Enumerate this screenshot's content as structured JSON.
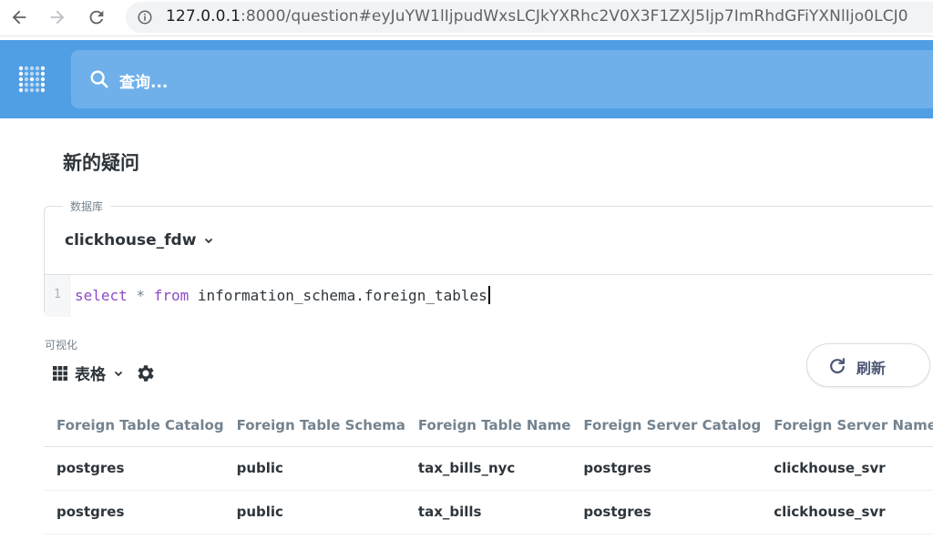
{
  "browser": {
    "url_host": "127.0.0.1",
    "url_rest": ":8000/question#eyJuYW1lIjpudWxsLCJkYXRhc2V0X3F1ZXJ5Ijp7ImRhdGFiYXNlIjo0LCJ0"
  },
  "header": {
    "search_placeholder": "查询..."
  },
  "page": {
    "title": "新的疑问"
  },
  "editor": {
    "db_label": "数据库",
    "db_name": "clickhouse_fdw",
    "line_number": "1",
    "code": {
      "kw1": "select",
      "star": " * ",
      "kw2": "from",
      "rest": " information_schema.foreign_tables"
    }
  },
  "visualization": {
    "label": "可视化",
    "type": "表格",
    "refresh_label": "刷新"
  },
  "table": {
    "columns": [
      "Foreign Table Catalog",
      "Foreign Table Schema",
      "Foreign Table Name",
      "Foreign Server Catalog",
      "Foreign Server Name"
    ],
    "rows": [
      [
        "postgres",
        "public",
        "tax_bills_nyc",
        "postgres",
        "clickhouse_svr"
      ],
      [
        "postgres",
        "public",
        "tax_bills",
        "postgres",
        "clickhouse_svr"
      ]
    ]
  },
  "colors": {
    "header_bg": "#509ee3",
    "search_bg": "#6fb0ea",
    "keyword": "#8c4bc8"
  }
}
